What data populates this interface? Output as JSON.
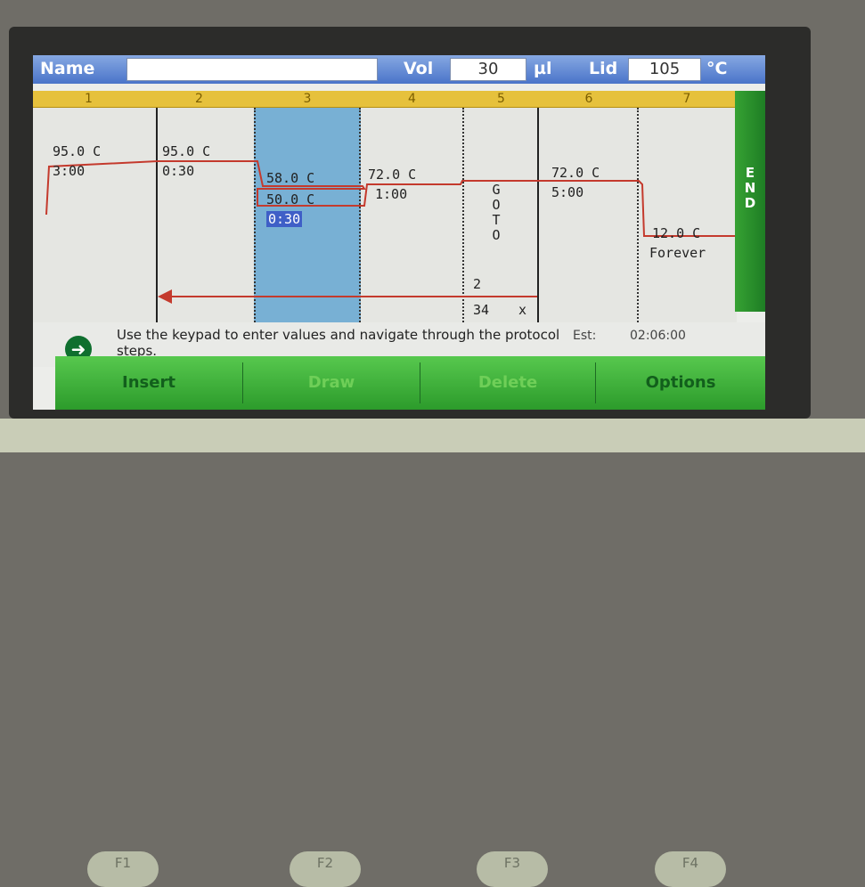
{
  "header": {
    "name_label": "Name",
    "name_value": "",
    "vol_label": "Vol",
    "vol_value": "30",
    "vol_unit": "µl",
    "lid_label": "Lid",
    "lid_value": "105",
    "lid_unit": "°C"
  },
  "steps": [
    {
      "number": "1",
      "temp": "95.0 C",
      "time": "3:00"
    },
    {
      "number": "2",
      "temp": "95.0 C",
      "time": "0:30"
    },
    {
      "number": "3",
      "temp_high": "58.0 C",
      "temp_low": "50.0 C",
      "time": "0:30"
    },
    {
      "number": "4",
      "temp": "72.0 C",
      "time": "1:00"
    },
    {
      "number": "5",
      "goto_text": "GOTO",
      "goto_step": "2",
      "repeats": "34",
      "repeat_mark": "x"
    },
    {
      "number": "6",
      "temp": "72.0 C",
      "time": "5:00"
    },
    {
      "number": "7",
      "temp": "12.0 C",
      "time": "Forever"
    }
  ],
  "end_label": "END",
  "help": {
    "text": "Use the keypad to enter values and navigate through the protocol steps.",
    "est_label": "Est:",
    "est_value": "02:06:00"
  },
  "softkeys": [
    {
      "label": "Insert"
    },
    {
      "label": "Draw"
    },
    {
      "label": "Delete"
    },
    {
      "label": "Options"
    }
  ],
  "device_keys": [
    "F1",
    "F2",
    "F3",
    "F4"
  ],
  "colors": {
    "title_bar": "#4a74c9",
    "step_header": "#e6c13c",
    "selected_step": "#78b0d4",
    "end_bar": "#1e7d24",
    "trace": "#c43a2d"
  }
}
